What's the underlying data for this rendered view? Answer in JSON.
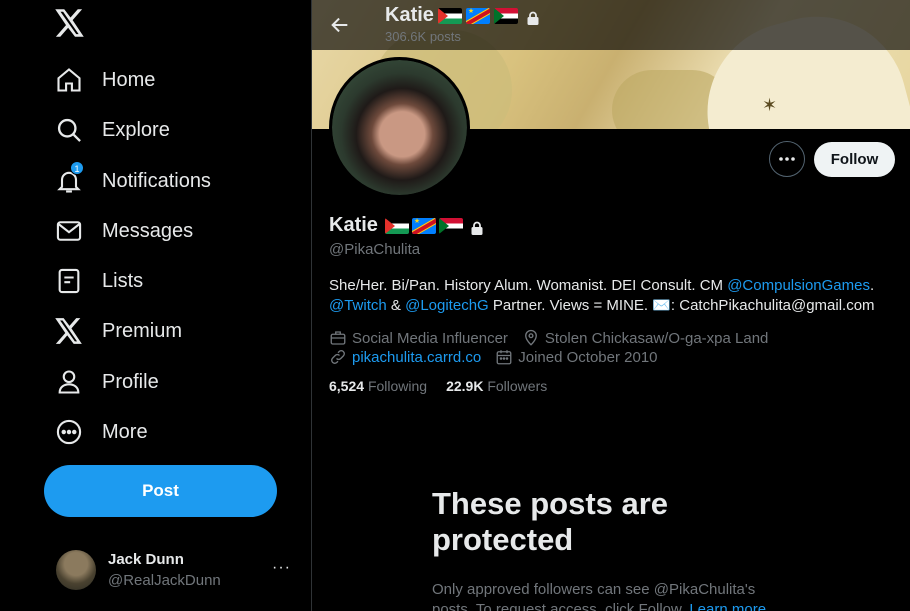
{
  "sidebar": {
    "nav": [
      {
        "label": "Home",
        "icon": "home-icon"
      },
      {
        "label": "Explore",
        "icon": "search-icon"
      },
      {
        "label": "Notifications",
        "icon": "bell-icon",
        "badge": "1"
      },
      {
        "label": "Messages",
        "icon": "mail-icon"
      },
      {
        "label": "Lists",
        "icon": "list-icon"
      },
      {
        "label": "Premium",
        "icon": "x-logo-icon"
      },
      {
        "label": "Profile",
        "icon": "person-icon"
      },
      {
        "label": "More",
        "icon": "more-circle-icon"
      }
    ],
    "post_label": "Post",
    "account": {
      "name": "Jack Dunn",
      "handle": "@RealJackDunn",
      "more": "···"
    }
  },
  "header": {
    "name": "Katie",
    "post_count": "306.6K posts",
    "flags": [
      "palestine-flag",
      "dr-congo-flag",
      "sudan-flag"
    ],
    "lock_icon": "lock-icon"
  },
  "profile": {
    "display_name": "Katie",
    "username": "@PikaChulita",
    "follow_label": "Follow",
    "bio": {
      "part1": "She/Her. Bi/Pan. History Alum. Womanist. DEI Consult. CM ",
      "link1": "@CompulsionGames",
      "part2": ".",
      "link2": "@Twitch",
      "part3": " & ",
      "link3": "@LogitechG",
      "part4": " Partner. Views = MINE. ✉️: CatchPikachulita@gmail.com"
    },
    "category": "Social Media Influencer",
    "location": "Stolen Chickasaw/O-ga-xpa Land",
    "website": "pikachulita.carrd.co",
    "joined": "Joined October 2010",
    "following_count": "6,524",
    "following_label": "Following",
    "followers_count": "22.9K",
    "followers_label": "Followers"
  },
  "protected_notice": {
    "title": "These posts are protected",
    "text": "Only approved followers can see @PikaChulita's posts. To request access, click Follow. ",
    "link": "Learn more"
  },
  "colors": {
    "accent": "#1d9bf0",
    "background": "#000000",
    "muted": "#71767b"
  }
}
